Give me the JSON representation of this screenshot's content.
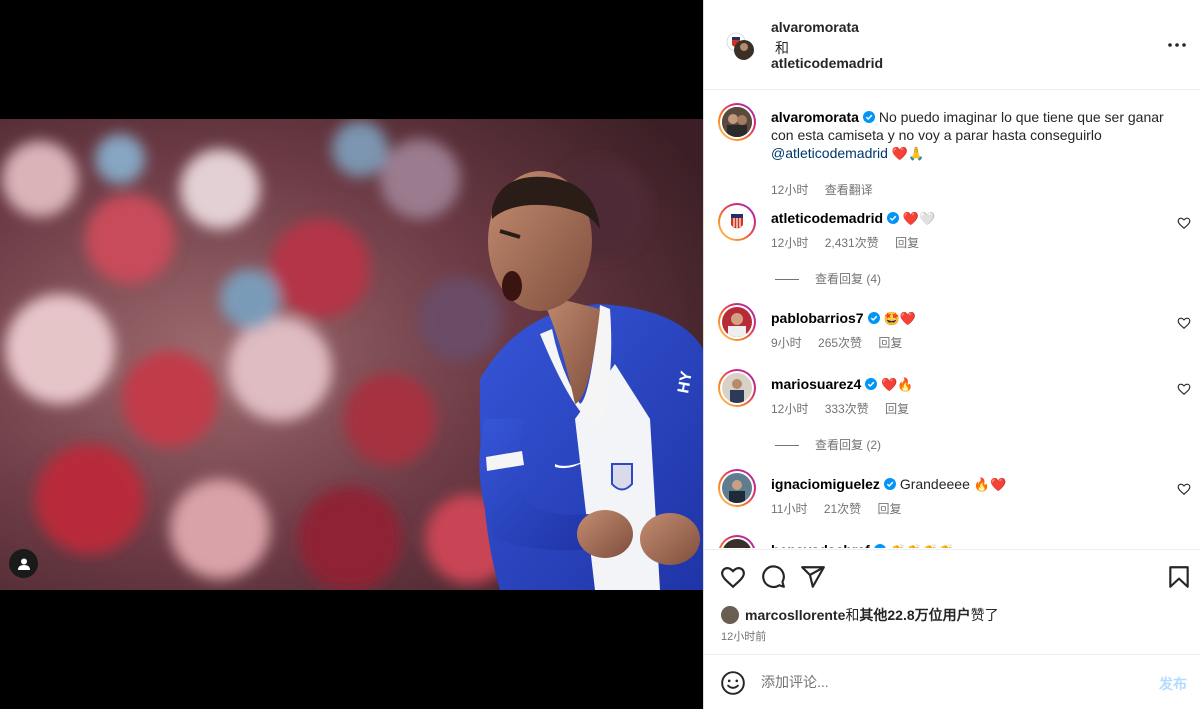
{
  "header": {
    "owner": "alvaromorata",
    "conjunction": "和",
    "collaborator": "atleticodemadrid"
  },
  "caption": {
    "username": "alvaromorata",
    "text": "No puedo imaginar lo que tiene que ser ganar con esta camiseta y no voy a parar hasta conseguirlo",
    "mention": "@atleticodemadrid",
    "emojis": "❤️🙏",
    "time": "12小时",
    "translate": "查看翻译"
  },
  "comments": [
    {
      "username": "atleticodemadrid",
      "text": "",
      "emojis": "❤️🤍",
      "time": "12小时",
      "likes": "2,431次赞",
      "reply": "回复",
      "view_replies": "查看回复 (4)"
    },
    {
      "username": "pablobarrios7",
      "text": "",
      "emojis": "🤩❤️",
      "time": "9小时",
      "likes": "265次赞",
      "reply": "回复"
    },
    {
      "username": "mariosuarez4",
      "text": "",
      "emojis": "❤️🔥",
      "time": "12小时",
      "likes": "333次赞",
      "reply": "回复",
      "view_replies": "查看回复 (2)"
    },
    {
      "username": "ignaciomiguelez",
      "text": "Grandeeee",
      "emojis": "🔥❤️",
      "time": "11小时",
      "likes": "21次赞",
      "reply": "回复"
    },
    {
      "username": "benayadachraf",
      "text": "",
      "emojis": "👏👏👏👏"
    }
  ],
  "likes": {
    "user": "marcosllorente",
    "connector": "和",
    "others": "其他22.8万位用户",
    "suffix": "赞了"
  },
  "post_time": "12小时前",
  "add_comment": {
    "placeholder": "添加评论...",
    "post_label": "发布"
  },
  "colors": {
    "verified": "#0095f6",
    "heart": "#ed4956",
    "link": "#00376b",
    "jersey_blue": "#2c47c8",
    "post_disabled": "#b3dbff"
  },
  "icons": [
    "more-icon",
    "verified-icon",
    "heart-icon",
    "comment-icon",
    "share-icon",
    "bookmark-icon",
    "emoji-icon",
    "user-tag-icon"
  ]
}
